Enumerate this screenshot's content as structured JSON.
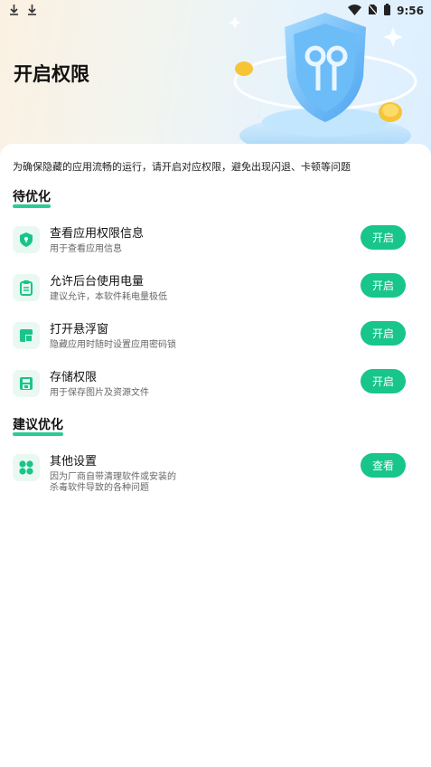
{
  "status_bar": {
    "time": "9:56",
    "left_icons": [
      "download-icon",
      "download-icon"
    ],
    "right_icons": [
      "wifi-icon",
      "no-sim-icon",
      "battery-icon"
    ]
  },
  "header": {
    "title": "开启权限"
  },
  "intro_text": "为确保隐藏的应用流畅的运行，请开启对应权限，避免出现闪退、卡顿等问题",
  "sections": [
    {
      "title": "待优化",
      "items": [
        {
          "title": "查看应用权限信息",
          "desc": "用于查看应用信息",
          "button": "开启",
          "icon": "shield-icon"
        },
        {
          "title": "允许后台使用电量",
          "desc": "建议允许，本软件耗电量极低",
          "button": "开启",
          "icon": "clipboard-icon"
        },
        {
          "title": "打开悬浮窗",
          "desc": "隐藏应用时随时设置应用密码锁",
          "button": "开启",
          "icon": "window-icon"
        },
        {
          "title": "存储权限",
          "desc": "用于保存图片及资源文件",
          "button": "开启",
          "icon": "save-icon"
        }
      ]
    },
    {
      "title": "建议优化",
      "items": [
        {
          "title": "其他设置",
          "desc": "因为厂商自带清理软件或安装的",
          "desc2": "杀毒软件导致的各种问题",
          "button": "查看",
          "icon": "clover-icon"
        }
      ]
    }
  ],
  "colors": {
    "accent": "#18c58a",
    "icon_bg": "#eaf8f2"
  }
}
